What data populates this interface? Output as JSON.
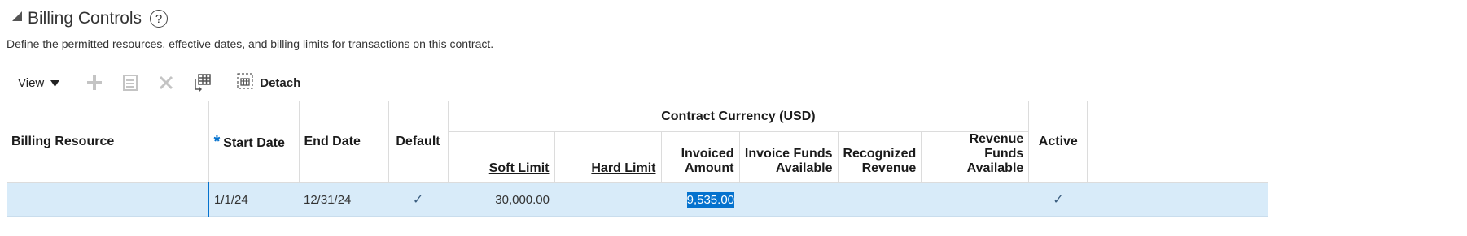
{
  "section": {
    "title": "Billing Controls",
    "help_symbol": "?",
    "description": "Define the permitted resources, effective dates, and billing limits for transactions on this contract."
  },
  "toolbar": {
    "view_label": "View",
    "detach_label": "Detach"
  },
  "table": {
    "columns": {
      "billing_resource": "Billing Resource",
      "required_marker": "*",
      "start_date": "Start Date",
      "end_date": "End Date",
      "default": "Default",
      "group_header": "Contract Currency (USD)",
      "soft_limit": "Soft Limit",
      "hard_limit": "Hard Limit",
      "invoiced_amount_1": "Invoiced",
      "invoiced_amount_2": "Amount",
      "invoice_funds_1": "Invoice Funds",
      "invoice_funds_2": "Available",
      "recognized_revenue_1": "Recognized",
      "recognized_revenue_2": "Revenue",
      "revenue_funds_1": "Revenue Funds",
      "revenue_funds_2": "Available",
      "active": "Active"
    },
    "rows": [
      {
        "billing_resource": "",
        "start_date": "1/1/24",
        "end_date": "12/31/24",
        "default_check": "✓",
        "soft_limit": "30,000.00",
        "hard_limit": "",
        "invoiced_amount": "9,535.00",
        "invoice_funds_available": "",
        "recognized_revenue": "",
        "revenue_funds_available": "",
        "active_check": "✓"
      }
    ]
  },
  "colors": {
    "selected_row": "#d8ebf9",
    "selection_highlight": "#0572ce",
    "required_marker": "#0572ce"
  }
}
